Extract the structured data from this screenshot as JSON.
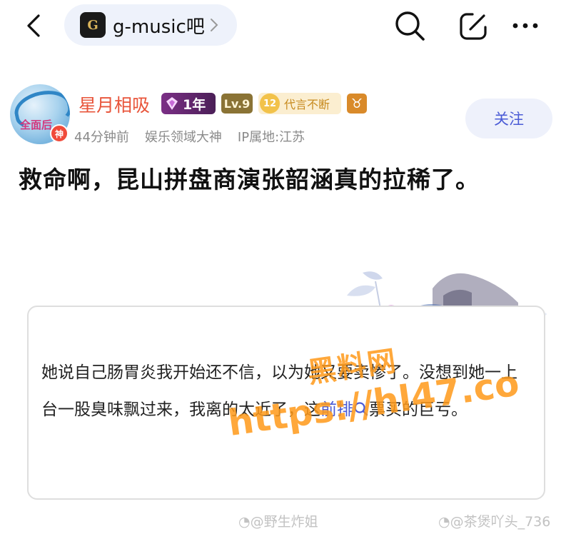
{
  "header": {
    "forum_name": "g-music吧",
    "logo_text": "G"
  },
  "author": {
    "name": "星月相吸",
    "avatar_text_1": "全面后",
    "avatar_text_2": "神",
    "member_years": "1年",
    "level": "Lv.9",
    "speaker_count": "12",
    "speaker_label": "代言不断",
    "zodiac": "♉",
    "time_ago": "44分钟前",
    "title_badge": "娱乐领域大神",
    "ip_location": "IP属地:江苏",
    "follow_label": "关注"
  },
  "post": {
    "title": "救命啊，昆山拼盘商演张韶涵真的拉稀了。",
    "body_part1": "她说自己肠胃炎我开始还不信，以为她又要卖惨了。没想到她一上台一股臭味飘过来，我离的太近了，这",
    "topic_link": "前排",
    "body_part2": "票买的巨亏。"
  },
  "watermark": {
    "line1": "黑料网",
    "line2": "https://hl47.co",
    "color": "#ff9a1a"
  },
  "footer": {
    "credit_left": "@野生炸姐",
    "credit_right": "@茶煲吖头_736"
  },
  "colors": {
    "accent": "#4a5bd6",
    "username": "#e8543a"
  }
}
